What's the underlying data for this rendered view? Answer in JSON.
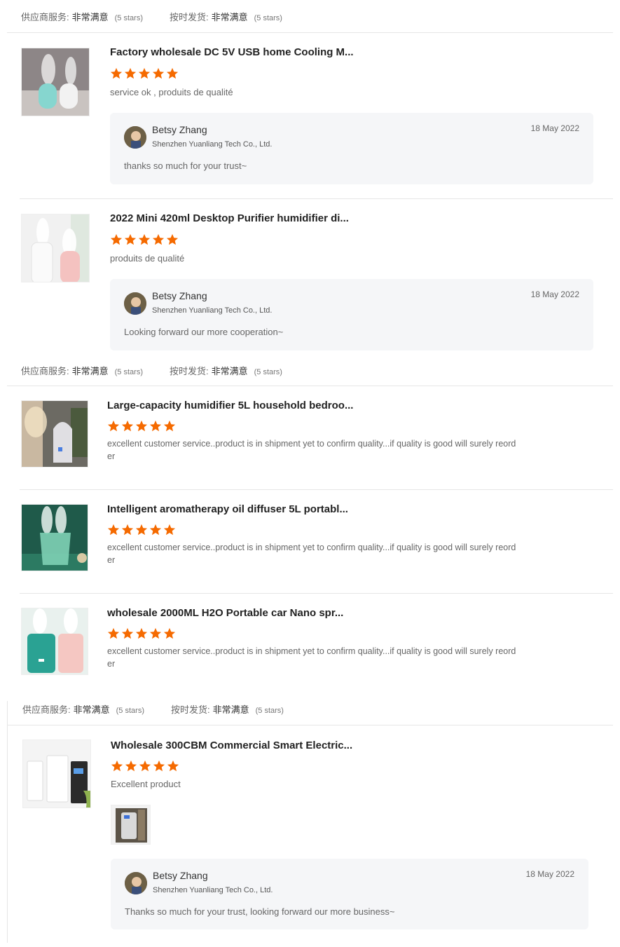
{
  "rating_bars": [
    {
      "supplier_label": "供应商服务:",
      "supplier_value": "非常满意",
      "supplier_stars": "(5 stars)",
      "ship_label": "按时发货:",
      "ship_value": "非常满意",
      "ship_stars": "(5 stars)"
    },
    {
      "supplier_label": "供应商服务:",
      "supplier_value": "非常满意",
      "supplier_stars": "(5 stars)",
      "ship_label": "按时发货:",
      "ship_value": "非常满意",
      "ship_stars": "(5 stars)"
    },
    {
      "supplier_label": "供应商服务:",
      "supplier_value": "非常满意",
      "supplier_stars": "(5 stars)",
      "ship_label": "按时发货:",
      "ship_value": "非常满意",
      "ship_stars": "(5 stars)"
    }
  ],
  "reviews": [
    {
      "title": "Factory wholesale DC 5V USB home Cooling M...",
      "rating": 5,
      "comment": "service ok , produits de qualité",
      "thumb_icon": "humidifier-photo"
    },
    {
      "title": "2022 Mini 420ml Desktop Purifier humidifier di...",
      "rating": 5,
      "comment": "produits de qualité",
      "thumb_icon": "humidifier-photo"
    },
    {
      "title": "Large-capacity humidifier 5L household bedroo...",
      "rating": 5,
      "comment_line1": "excellent customer service..product is in shipment yet to confirm quality...if quality is good will surely reord",
      "comment_line2": "er",
      "thumb_icon": "humidifier-photo"
    },
    {
      "title": "Intelligent aromatherapy oil diffuser 5L portabl...",
      "rating": 5,
      "comment_line1": "excellent customer service..product is in shipment yet to confirm quality...if quality is good will surely reord",
      "comment_line2": "er",
      "thumb_icon": "diffuser-photo"
    },
    {
      "title": "wholesale 2000ML H2O Portable car Nano spr...",
      "rating": 5,
      "comment_line1": "excellent customer service..product is in shipment yet to confirm quality...if quality is good will surely reord",
      "comment_line2": "er",
      "thumb_icon": "humidifier-photo"
    },
    {
      "title": "Wholesale 300CBM Commercial Smart Electric...",
      "rating": 5,
      "comment": "Excellent product",
      "thumb_icon": "scent-machine-photo"
    }
  ],
  "replies": [
    {
      "name": "Betsy Zhang",
      "company": "Shenzhen Yuanliang Tech Co., Ltd.",
      "date": "18 May 2022",
      "text": "thanks so much for your trust~"
    },
    {
      "name": "Betsy Zhang",
      "company": "Shenzhen Yuanliang Tech Co., Ltd.",
      "date": "18 May 2022",
      "text": "Looking forward our more cooperation~"
    },
    {
      "name": "Betsy Zhang",
      "company": "Shenzhen Yuanliang Tech Co., Ltd.",
      "date": "18 May 2022",
      "text": "Thanks so much for your trust, looking forward our more business~"
    }
  ],
  "colors": {
    "star": "#f56a00",
    "reply_bg": "#f5f6f8",
    "divider": "#e6e6e6"
  }
}
